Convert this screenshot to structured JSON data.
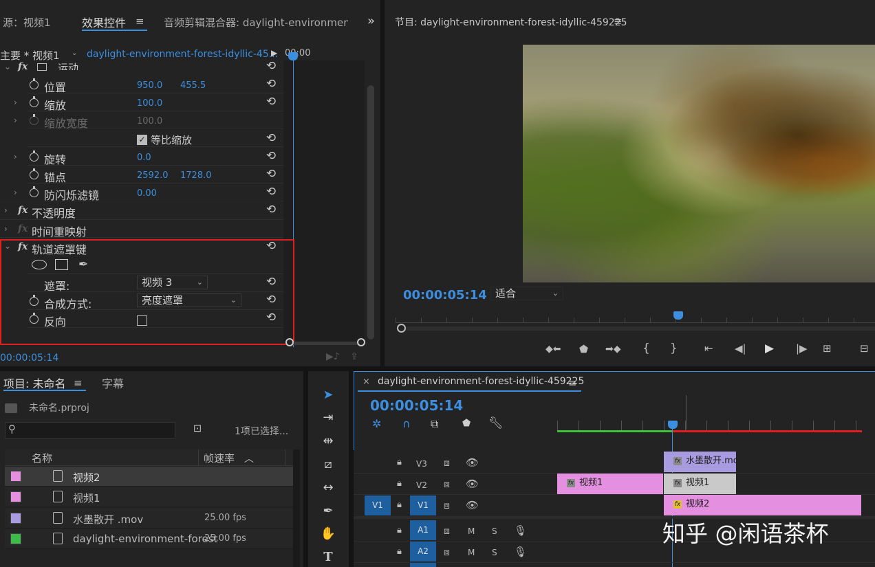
{
  "tabs_top_left": {
    "source": "源：视频1",
    "effect_controls": "效果控件",
    "menu": "≡",
    "audio_mixer": "音频剪辑混合器: daylight-environment-f",
    "more": "»"
  },
  "ec_header": {
    "master": "主要 * 视频1",
    "sequence": "daylight-environment-forest-idyllic-45...",
    "timecode_ruler": "00:00"
  },
  "motion": {
    "label": "运动",
    "position_label": "位置",
    "position_x": "950.0",
    "position_y": "455.5",
    "scale_label": "缩放",
    "scale_value": "100.0",
    "scale_width_label": "缩放宽度",
    "scale_width_value": "100.0",
    "uniform_scale_label": "等比缩放",
    "rotation_label": "旋转",
    "rotation_value": "0.0",
    "anchor_label": "锚点",
    "anchor_x": "2592.0",
    "anchor_y": "1728.0",
    "flicker_label": "防闪烁滤镜",
    "flicker_value": "0.00"
  },
  "opacity_label": "不透明度",
  "time_remap_label": "时间重映射",
  "track_matte": {
    "label": "轨道遮罩键",
    "matte_label": "遮罩:",
    "matte_value": "视频 3",
    "composite_label": "合成方式:",
    "composite_value": "亮度遮罩",
    "reverse_label": "反向"
  },
  "ec_footer_timecode": "00:00:05:14",
  "program": {
    "title": "节目: daylight-environment-forest-idyllic-459225",
    "menu": "≡",
    "timecode": "00:00:05:14",
    "fit": "适合"
  },
  "project": {
    "tab": "项目: 未命名",
    "menu": "≡",
    "captions_tab": "字幕",
    "file": "未命名.prproj",
    "selection": "1项已选择...",
    "col_name": "名称",
    "col_fps": "帧速率",
    "items": [
      {
        "name": "视频2",
        "fps": "",
        "color": "#e58fe0",
        "icon": "sequence-icon"
      },
      {
        "name": "视频1",
        "fps": "",
        "color": "#e58fe0",
        "icon": "sequence-icon"
      },
      {
        "name": "水墨散开 .mov",
        "fps": "25.00 fps",
        "color": "#a99be0",
        "icon": "film-icon"
      },
      {
        "name": "daylight-environment-forest",
        "fps": "25.00 fps",
        "color": "#3dbb4b",
        "icon": "sequence-timeline-icon"
      }
    ]
  },
  "timeline": {
    "close": "×",
    "title": "daylight-environment-forest-idyllic-459225",
    "menu": "≡",
    "timecode": "00:00:05:14",
    "tracks": {
      "v3": "V3",
      "v2": "V2",
      "v1": "V1",
      "v1_src": "V1",
      "a1": "A1",
      "a2": "A2",
      "m": "M",
      "s": "S"
    },
    "clips": {
      "ink": "水墨散开.mov",
      "v2_left": "视频1",
      "v2_right": "视频1",
      "v1_clip": "视频2"
    }
  },
  "watermark": "知乎 @闲语茶杯",
  "colors": {
    "accent": "#3c8fe0",
    "highlight_box": "#e0201f",
    "clip_pink": "#e58fe0",
    "clip_purple": "#a99be0",
    "clip_gray": "#c9c9c9"
  }
}
